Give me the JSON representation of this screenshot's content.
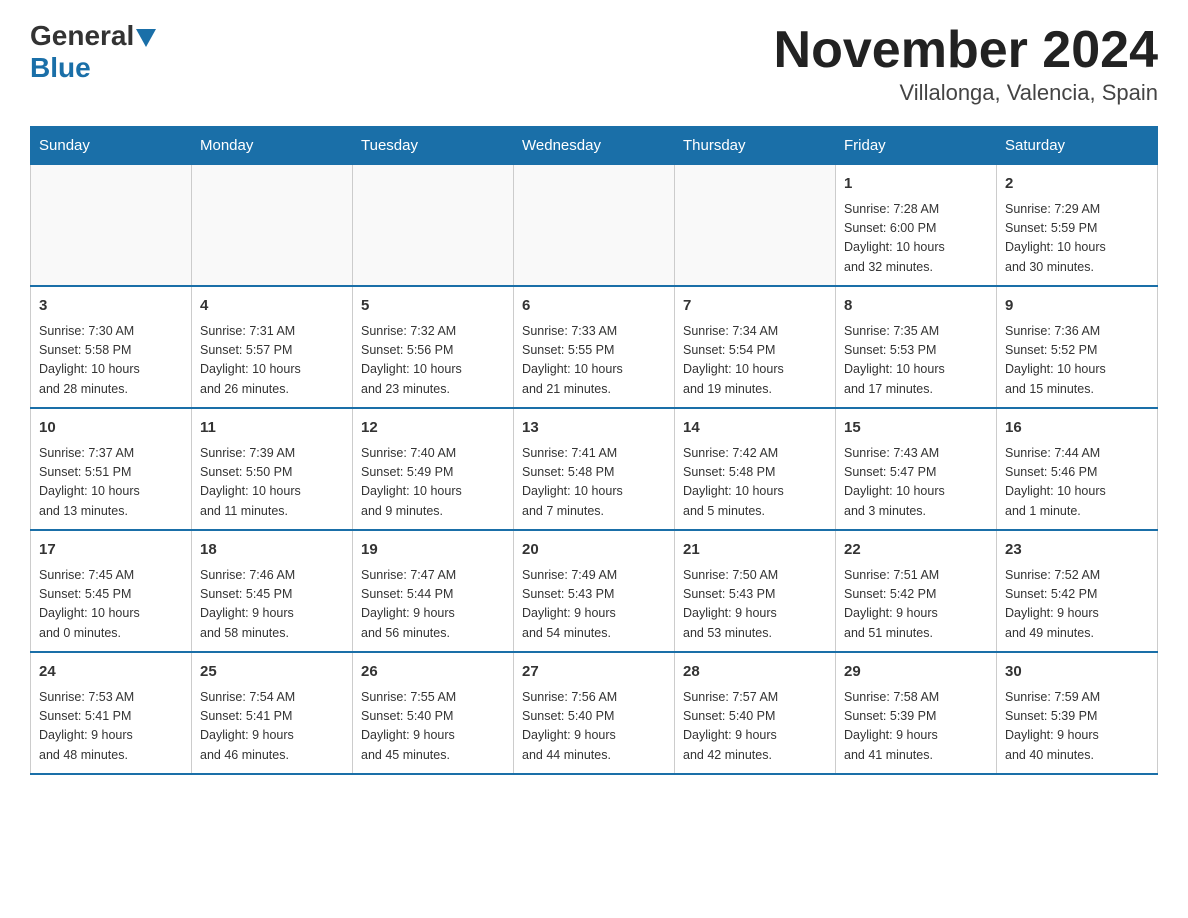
{
  "header": {
    "logo_general": "General",
    "logo_blue": "Blue",
    "title": "November 2024",
    "subtitle": "Villalonga, Valencia, Spain"
  },
  "days_of_week": [
    "Sunday",
    "Monday",
    "Tuesday",
    "Wednesday",
    "Thursday",
    "Friday",
    "Saturday"
  ],
  "weeks": [
    {
      "days": [
        {
          "num": "",
          "detail": ""
        },
        {
          "num": "",
          "detail": ""
        },
        {
          "num": "",
          "detail": ""
        },
        {
          "num": "",
          "detail": ""
        },
        {
          "num": "",
          "detail": ""
        },
        {
          "num": "1",
          "detail": "Sunrise: 7:28 AM\nSunset: 6:00 PM\nDaylight: 10 hours\nand 32 minutes."
        },
        {
          "num": "2",
          "detail": "Sunrise: 7:29 AM\nSunset: 5:59 PM\nDaylight: 10 hours\nand 30 minutes."
        }
      ]
    },
    {
      "days": [
        {
          "num": "3",
          "detail": "Sunrise: 7:30 AM\nSunset: 5:58 PM\nDaylight: 10 hours\nand 28 minutes."
        },
        {
          "num": "4",
          "detail": "Sunrise: 7:31 AM\nSunset: 5:57 PM\nDaylight: 10 hours\nand 26 minutes."
        },
        {
          "num": "5",
          "detail": "Sunrise: 7:32 AM\nSunset: 5:56 PM\nDaylight: 10 hours\nand 23 minutes."
        },
        {
          "num": "6",
          "detail": "Sunrise: 7:33 AM\nSunset: 5:55 PM\nDaylight: 10 hours\nand 21 minutes."
        },
        {
          "num": "7",
          "detail": "Sunrise: 7:34 AM\nSunset: 5:54 PM\nDaylight: 10 hours\nand 19 minutes."
        },
        {
          "num": "8",
          "detail": "Sunrise: 7:35 AM\nSunset: 5:53 PM\nDaylight: 10 hours\nand 17 minutes."
        },
        {
          "num": "9",
          "detail": "Sunrise: 7:36 AM\nSunset: 5:52 PM\nDaylight: 10 hours\nand 15 minutes."
        }
      ]
    },
    {
      "days": [
        {
          "num": "10",
          "detail": "Sunrise: 7:37 AM\nSunset: 5:51 PM\nDaylight: 10 hours\nand 13 minutes."
        },
        {
          "num": "11",
          "detail": "Sunrise: 7:39 AM\nSunset: 5:50 PM\nDaylight: 10 hours\nand 11 minutes."
        },
        {
          "num": "12",
          "detail": "Sunrise: 7:40 AM\nSunset: 5:49 PM\nDaylight: 10 hours\nand 9 minutes."
        },
        {
          "num": "13",
          "detail": "Sunrise: 7:41 AM\nSunset: 5:48 PM\nDaylight: 10 hours\nand 7 minutes."
        },
        {
          "num": "14",
          "detail": "Sunrise: 7:42 AM\nSunset: 5:48 PM\nDaylight: 10 hours\nand 5 minutes."
        },
        {
          "num": "15",
          "detail": "Sunrise: 7:43 AM\nSunset: 5:47 PM\nDaylight: 10 hours\nand 3 minutes."
        },
        {
          "num": "16",
          "detail": "Sunrise: 7:44 AM\nSunset: 5:46 PM\nDaylight: 10 hours\nand 1 minute."
        }
      ]
    },
    {
      "days": [
        {
          "num": "17",
          "detail": "Sunrise: 7:45 AM\nSunset: 5:45 PM\nDaylight: 10 hours\nand 0 minutes."
        },
        {
          "num": "18",
          "detail": "Sunrise: 7:46 AM\nSunset: 5:45 PM\nDaylight: 9 hours\nand 58 minutes."
        },
        {
          "num": "19",
          "detail": "Sunrise: 7:47 AM\nSunset: 5:44 PM\nDaylight: 9 hours\nand 56 minutes."
        },
        {
          "num": "20",
          "detail": "Sunrise: 7:49 AM\nSunset: 5:43 PM\nDaylight: 9 hours\nand 54 minutes."
        },
        {
          "num": "21",
          "detail": "Sunrise: 7:50 AM\nSunset: 5:43 PM\nDaylight: 9 hours\nand 53 minutes."
        },
        {
          "num": "22",
          "detail": "Sunrise: 7:51 AM\nSunset: 5:42 PM\nDaylight: 9 hours\nand 51 minutes."
        },
        {
          "num": "23",
          "detail": "Sunrise: 7:52 AM\nSunset: 5:42 PM\nDaylight: 9 hours\nand 49 minutes."
        }
      ]
    },
    {
      "days": [
        {
          "num": "24",
          "detail": "Sunrise: 7:53 AM\nSunset: 5:41 PM\nDaylight: 9 hours\nand 48 minutes."
        },
        {
          "num": "25",
          "detail": "Sunrise: 7:54 AM\nSunset: 5:41 PM\nDaylight: 9 hours\nand 46 minutes."
        },
        {
          "num": "26",
          "detail": "Sunrise: 7:55 AM\nSunset: 5:40 PM\nDaylight: 9 hours\nand 45 minutes."
        },
        {
          "num": "27",
          "detail": "Sunrise: 7:56 AM\nSunset: 5:40 PM\nDaylight: 9 hours\nand 44 minutes."
        },
        {
          "num": "28",
          "detail": "Sunrise: 7:57 AM\nSunset: 5:40 PM\nDaylight: 9 hours\nand 42 minutes."
        },
        {
          "num": "29",
          "detail": "Sunrise: 7:58 AM\nSunset: 5:39 PM\nDaylight: 9 hours\nand 41 minutes."
        },
        {
          "num": "30",
          "detail": "Sunrise: 7:59 AM\nSunset: 5:39 PM\nDaylight: 9 hours\nand 40 minutes."
        }
      ]
    }
  ]
}
